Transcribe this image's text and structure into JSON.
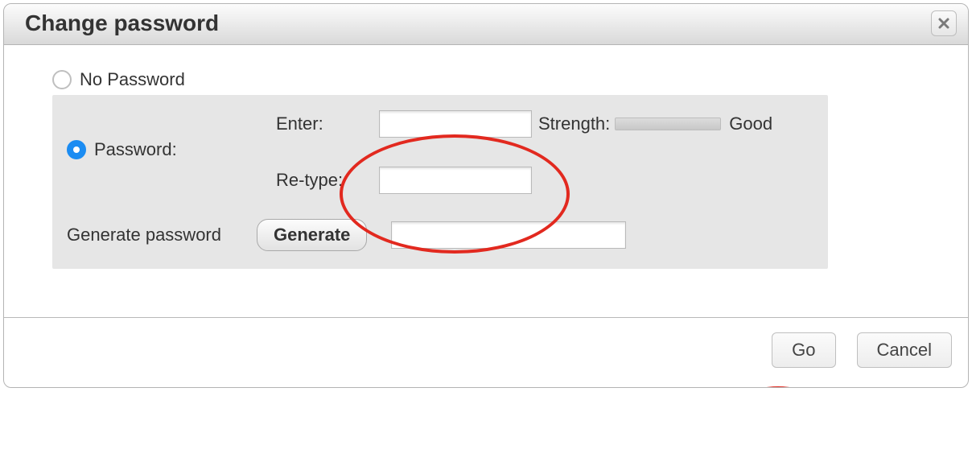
{
  "title": "Change password",
  "options": {
    "no_password_label": "No Password",
    "password_label": "Password:"
  },
  "fields": {
    "enter_label": "Enter:",
    "retype_label": "Re-type:",
    "enter_value": "",
    "retype_value": ""
  },
  "strength": {
    "label": "Strength:",
    "value_label": "Good"
  },
  "generate": {
    "label": "Generate password",
    "button_label": "Generate",
    "output_value": ""
  },
  "footer": {
    "go_label": "Go",
    "cancel_label": "Cancel"
  },
  "annotations": {
    "highlight_inputs": true,
    "highlight_go": true
  }
}
